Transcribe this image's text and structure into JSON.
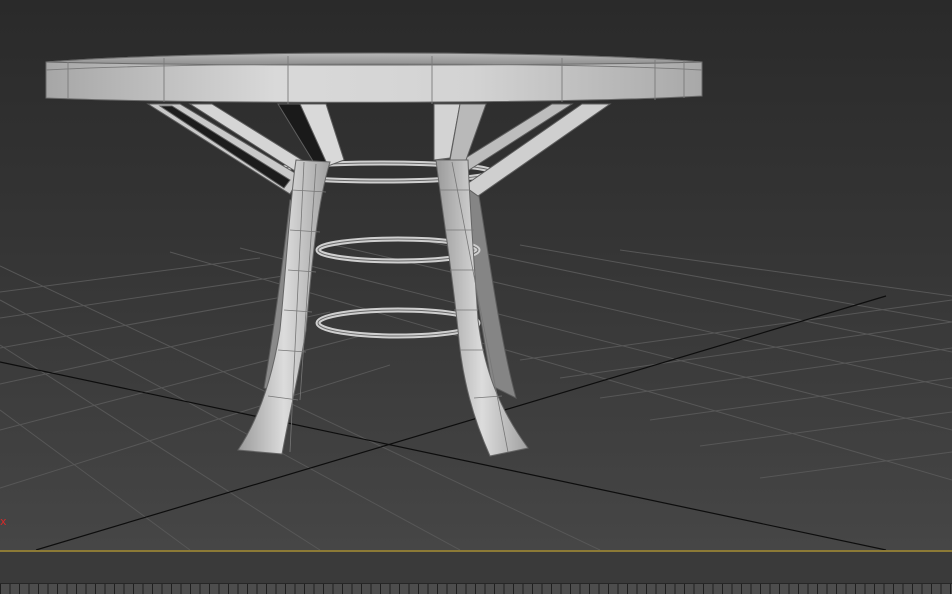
{
  "viewport": {
    "view": "perspective",
    "shading": "default-shading-with-edged-faces",
    "object": "round-table-model",
    "axis_indicator": "x"
  },
  "timeline": {
    "tick_count": 100
  },
  "colors": {
    "background_top": "#2a2a2a",
    "background_bottom": "#464646",
    "grid_line": "#595959",
    "grid_axis": "#000000",
    "model_light": "#d6d6d6",
    "model_dark": "#8a8a8a",
    "edge_line": "#6e6e6e",
    "timeline_separator": "#8c7a36",
    "axis_x": "#d42a2a"
  }
}
